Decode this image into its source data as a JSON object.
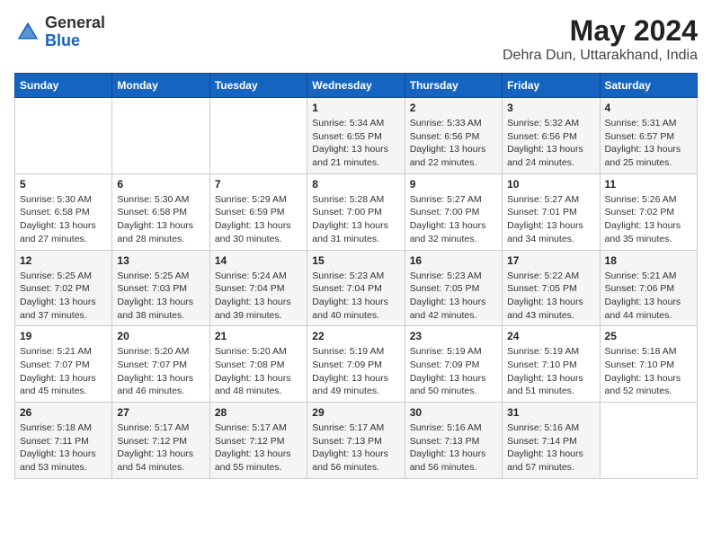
{
  "header": {
    "logo_general": "General",
    "logo_blue": "Blue",
    "month_year": "May 2024",
    "location": "Dehra Dun, Uttarakhand, India"
  },
  "days_of_week": [
    "Sunday",
    "Monday",
    "Tuesday",
    "Wednesday",
    "Thursday",
    "Friday",
    "Saturday"
  ],
  "weeks": [
    [
      {
        "day": "",
        "info": ""
      },
      {
        "day": "",
        "info": ""
      },
      {
        "day": "",
        "info": ""
      },
      {
        "day": "1",
        "info": "Sunrise: 5:34 AM\nSunset: 6:55 PM\nDaylight: 13 hours\nand 21 minutes."
      },
      {
        "day": "2",
        "info": "Sunrise: 5:33 AM\nSunset: 6:56 PM\nDaylight: 13 hours\nand 22 minutes."
      },
      {
        "day": "3",
        "info": "Sunrise: 5:32 AM\nSunset: 6:56 PM\nDaylight: 13 hours\nand 24 minutes."
      },
      {
        "day": "4",
        "info": "Sunrise: 5:31 AM\nSunset: 6:57 PM\nDaylight: 13 hours\nand 25 minutes."
      }
    ],
    [
      {
        "day": "5",
        "info": "Sunrise: 5:30 AM\nSunset: 6:58 PM\nDaylight: 13 hours\nand 27 minutes."
      },
      {
        "day": "6",
        "info": "Sunrise: 5:30 AM\nSunset: 6:58 PM\nDaylight: 13 hours\nand 28 minutes."
      },
      {
        "day": "7",
        "info": "Sunrise: 5:29 AM\nSunset: 6:59 PM\nDaylight: 13 hours\nand 30 minutes."
      },
      {
        "day": "8",
        "info": "Sunrise: 5:28 AM\nSunset: 7:00 PM\nDaylight: 13 hours\nand 31 minutes."
      },
      {
        "day": "9",
        "info": "Sunrise: 5:27 AM\nSunset: 7:00 PM\nDaylight: 13 hours\nand 32 minutes."
      },
      {
        "day": "10",
        "info": "Sunrise: 5:27 AM\nSunset: 7:01 PM\nDaylight: 13 hours\nand 34 minutes."
      },
      {
        "day": "11",
        "info": "Sunrise: 5:26 AM\nSunset: 7:02 PM\nDaylight: 13 hours\nand 35 minutes."
      }
    ],
    [
      {
        "day": "12",
        "info": "Sunrise: 5:25 AM\nSunset: 7:02 PM\nDaylight: 13 hours\nand 37 minutes."
      },
      {
        "day": "13",
        "info": "Sunrise: 5:25 AM\nSunset: 7:03 PM\nDaylight: 13 hours\nand 38 minutes."
      },
      {
        "day": "14",
        "info": "Sunrise: 5:24 AM\nSunset: 7:04 PM\nDaylight: 13 hours\nand 39 minutes."
      },
      {
        "day": "15",
        "info": "Sunrise: 5:23 AM\nSunset: 7:04 PM\nDaylight: 13 hours\nand 40 minutes."
      },
      {
        "day": "16",
        "info": "Sunrise: 5:23 AM\nSunset: 7:05 PM\nDaylight: 13 hours\nand 42 minutes."
      },
      {
        "day": "17",
        "info": "Sunrise: 5:22 AM\nSunset: 7:05 PM\nDaylight: 13 hours\nand 43 minutes."
      },
      {
        "day": "18",
        "info": "Sunrise: 5:21 AM\nSunset: 7:06 PM\nDaylight: 13 hours\nand 44 minutes."
      }
    ],
    [
      {
        "day": "19",
        "info": "Sunrise: 5:21 AM\nSunset: 7:07 PM\nDaylight: 13 hours\nand 45 minutes."
      },
      {
        "day": "20",
        "info": "Sunrise: 5:20 AM\nSunset: 7:07 PM\nDaylight: 13 hours\nand 46 minutes."
      },
      {
        "day": "21",
        "info": "Sunrise: 5:20 AM\nSunset: 7:08 PM\nDaylight: 13 hours\nand 48 minutes."
      },
      {
        "day": "22",
        "info": "Sunrise: 5:19 AM\nSunset: 7:09 PM\nDaylight: 13 hours\nand 49 minutes."
      },
      {
        "day": "23",
        "info": "Sunrise: 5:19 AM\nSunset: 7:09 PM\nDaylight: 13 hours\nand 50 minutes."
      },
      {
        "day": "24",
        "info": "Sunrise: 5:19 AM\nSunset: 7:10 PM\nDaylight: 13 hours\nand 51 minutes."
      },
      {
        "day": "25",
        "info": "Sunrise: 5:18 AM\nSunset: 7:10 PM\nDaylight: 13 hours\nand 52 minutes."
      }
    ],
    [
      {
        "day": "26",
        "info": "Sunrise: 5:18 AM\nSunset: 7:11 PM\nDaylight: 13 hours\nand 53 minutes."
      },
      {
        "day": "27",
        "info": "Sunrise: 5:17 AM\nSunset: 7:12 PM\nDaylight: 13 hours\nand 54 minutes."
      },
      {
        "day": "28",
        "info": "Sunrise: 5:17 AM\nSunset: 7:12 PM\nDaylight: 13 hours\nand 55 minutes."
      },
      {
        "day": "29",
        "info": "Sunrise: 5:17 AM\nSunset: 7:13 PM\nDaylight: 13 hours\nand 56 minutes."
      },
      {
        "day": "30",
        "info": "Sunrise: 5:16 AM\nSunset: 7:13 PM\nDaylight: 13 hours\nand 56 minutes."
      },
      {
        "day": "31",
        "info": "Sunrise: 5:16 AM\nSunset: 7:14 PM\nDaylight: 13 hours\nand 57 minutes."
      },
      {
        "day": "",
        "info": ""
      }
    ]
  ]
}
